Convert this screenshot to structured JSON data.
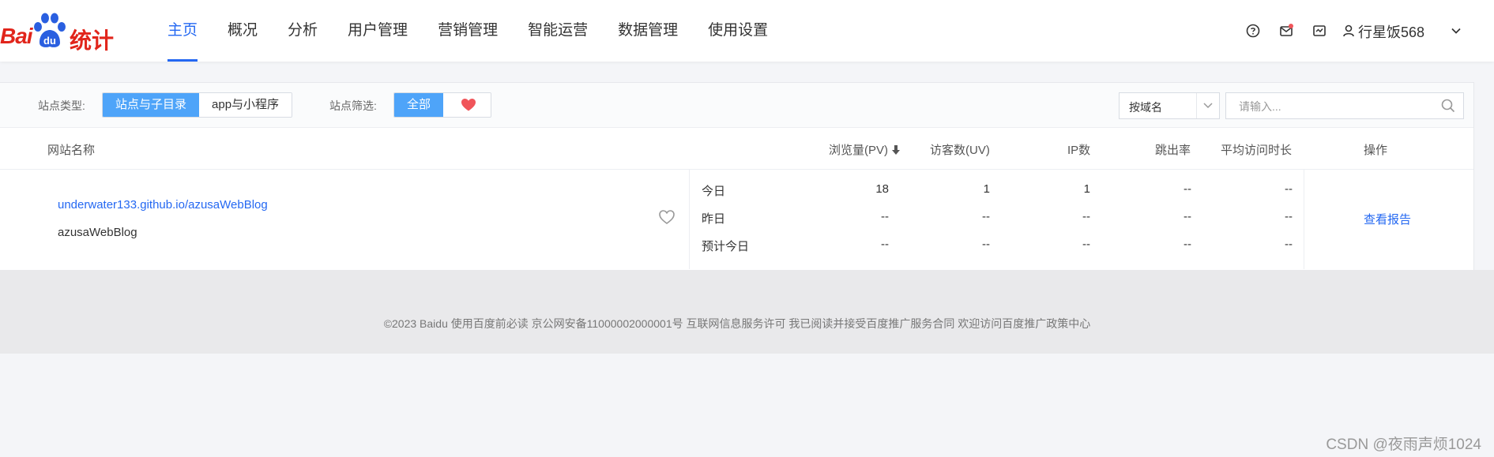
{
  "logo": {
    "left_text": "Bai",
    "paw_text": "du",
    "right_text": "统计"
  },
  "nav": [
    {
      "label": "主页",
      "active": true
    },
    {
      "label": "概况"
    },
    {
      "label": "分析"
    },
    {
      "label": "用户管理"
    },
    {
      "label": "营销管理"
    },
    {
      "label": "智能运营"
    },
    {
      "label": "数据管理"
    },
    {
      "label": "使用设置"
    }
  ],
  "header_right": {
    "icons": [
      "help-icon",
      "mail-icon",
      "inbox-icon",
      "user-icon",
      "chevron-down-icon"
    ],
    "username": "行星饭568"
  },
  "filters": {
    "site_type_label": "站点类型:",
    "site_type_options": [
      "站点与子目录",
      "app与小程序"
    ],
    "site_filter_label": "站点筛选:",
    "site_filter_options": [
      "全部"
    ],
    "select_value": "按域名",
    "search_placeholder": "请输入..."
  },
  "table": {
    "headers": {
      "site": "网站名称",
      "pv": "浏览量(PV)",
      "uv": "访客数(UV)",
      "ip": "IP数",
      "bounce": "跳出率",
      "avg_time": "平均访问时长",
      "action": "操作"
    },
    "row": {
      "link": "underwater133.github.io/azusaWebBlog",
      "name": "azusaWebBlog",
      "periods": [
        {
          "label": "今日",
          "pv": "18",
          "uv": "1",
          "ip": "1",
          "bounce": "--",
          "avg": "--"
        },
        {
          "label": "昨日",
          "pv": "--",
          "uv": "--",
          "ip": "--",
          "bounce": "--",
          "avg": "--"
        },
        {
          "label": "预计今日",
          "pv": "--",
          "uv": "--",
          "ip": "--",
          "bounce": "--",
          "avg": "--"
        }
      ],
      "action_label": "查看报告"
    }
  },
  "footer": "©2023 Baidu 使用百度前必读 京公网安备11000002000001号 互联网信息服务许可 我已阅读并接受百度推广服务合同 欢迎访问百度推广政策中心",
  "watermark": "CSDN @夜雨声烦1024",
  "colors": {
    "accent": "#2468f2",
    "brand_red": "#e1251b",
    "segment_on": "#4ea4f9",
    "heart": "#f0555a"
  }
}
